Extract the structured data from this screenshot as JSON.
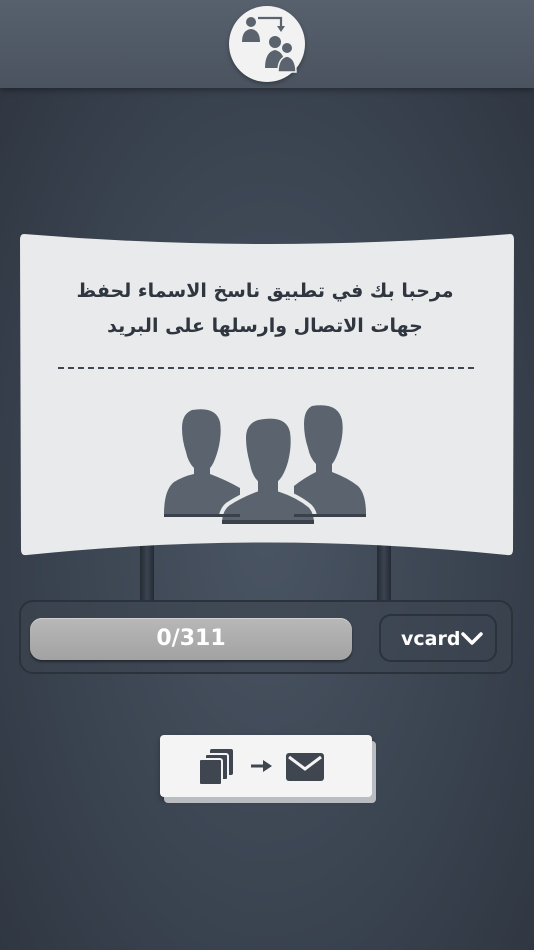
{
  "welcome": {
    "line1": "مرحبا بك في تطبيق ناسخ الاسماء لحفظ",
    "line2": "جهات الاتصال وارسلها على  البريد"
  },
  "progress": {
    "text": "0/311",
    "done": 0,
    "total": 311
  },
  "format": {
    "selected": "vcard"
  },
  "icons": {
    "logo": "copy-contacts-icon",
    "contacts": "contacts-group-icon",
    "copy": "copy-icon",
    "arrow": "arrow-right-icon",
    "mail": "mail-icon",
    "chevron": "chevron-down-icon"
  },
  "colors": {
    "background": "#3a4350",
    "header": "#525b68",
    "board": "#e9eaeb",
    "person": "#5a636e",
    "progress": "#ababab",
    "text_dark": "#2f3640"
  }
}
